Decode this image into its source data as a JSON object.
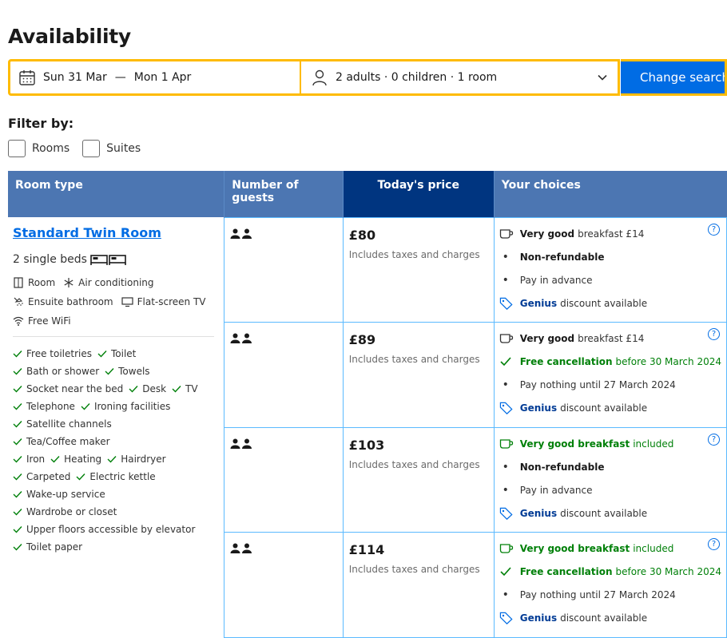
{
  "page": {
    "title": "Availability"
  },
  "search": {
    "checkin": "Sun 31 Mar",
    "separator": "—",
    "checkout": "Mon 1 Apr",
    "guests": "2 adults · 0 children · 1 room",
    "button_label": "Change search"
  },
  "filter": {
    "title": "Filter by:",
    "options": [
      "Rooms",
      "Suites"
    ]
  },
  "table": {
    "headers": {
      "room_type": "Room type",
      "guests": "Number of guests",
      "price": "Today's price",
      "choices": "Your choices"
    },
    "room": {
      "name": "Standard Twin Room",
      "beds": "2 single beds",
      "features": [
        "Room",
        "Air conditioning",
        "Ensuite bathroom",
        "Flat-screen TV",
        "Free WiFi"
      ],
      "amenities": [
        [
          "Free toiletries",
          "Toilet"
        ],
        [
          "Bath or shower",
          "Towels"
        ],
        [
          "Socket near the bed",
          "Desk",
          "TV"
        ],
        [
          "Telephone",
          "Ironing facilities"
        ],
        [
          "Satellite channels",
          "Tea/Coffee maker"
        ],
        [
          "Iron",
          "Heating",
          "Hairdryer"
        ],
        [
          "Carpeted",
          "Electric kettle"
        ],
        [
          "Wake-up service",
          "Wardrobe or closet"
        ],
        [
          "Upper floors accessible by elevator"
        ],
        [
          "Toilet paper"
        ]
      ]
    },
    "rows": [
      {
        "price": "£80",
        "price_note": "Includes taxes and charges",
        "breakfast_bold": "Very good",
        "breakfast_rest": "breakfast £14",
        "policy_bold": "Non-refundable",
        "policy_rest": "",
        "payment": "Pay in advance",
        "genius": "Genius",
        "genius_rest": "discount available"
      },
      {
        "price": "£89",
        "price_note": "Includes taxes and charges",
        "breakfast_bold": "Very good",
        "breakfast_rest": "breakfast £14",
        "policy_bold": "Free cancellation",
        "policy_rest": "before 30 March 2024",
        "payment": "Pay nothing until 27 March 2024",
        "genius": "Genius",
        "genius_rest": "discount available"
      },
      {
        "price": "£103",
        "price_note": "Includes taxes and charges",
        "breakfast_bold": "Very good breakfast",
        "breakfast_rest": "included",
        "policy_bold": "Non-refundable",
        "policy_rest": "",
        "payment": "Pay in advance",
        "genius": "Genius",
        "genius_rest": "discount available"
      },
      {
        "price": "£114",
        "price_note": "Includes taxes and charges",
        "breakfast_bold": "Very good breakfast",
        "breakfast_rest": "included",
        "policy_bold": "Free cancellation",
        "policy_rest": "before 30 March 2024",
        "payment": "Pay nothing until 27 March 2024",
        "genius": "Genius",
        "genius_rest": "discount available"
      }
    ],
    "help_glyph": "?"
  },
  "colors": {
    "header_blue": "#4c76b2",
    "price_header": "#003580",
    "accent": "#006ce4",
    "highlight": "#febb02",
    "green": "#008009",
    "cell_border": "#5bbaff"
  }
}
